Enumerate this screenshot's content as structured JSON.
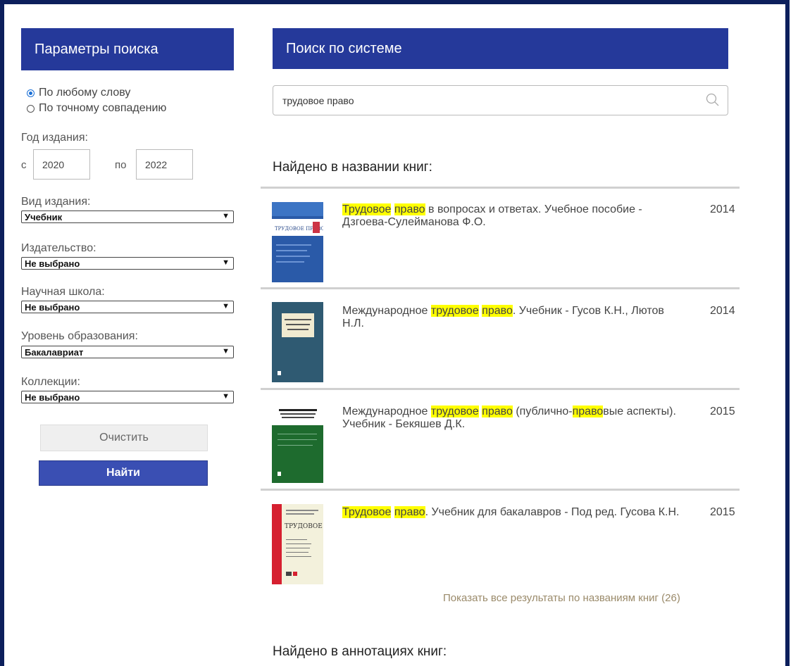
{
  "sidebar": {
    "title": "Параметры поиска",
    "match_any": "По любому слову",
    "match_exact": "По точному совпадению",
    "year_label": "Год издания:",
    "year_from_prefix": "с",
    "year_from": "2020",
    "year_to_prefix": "по",
    "year_to": "2022",
    "type_label": "Вид издания:",
    "type_value": "Учебник",
    "publisher_label": "Издательство:",
    "publisher_value": "Не выбрано",
    "school_label": "Научная школа:",
    "school_value": "Не выбрано",
    "level_label": "Уровень образования:",
    "level_value": "Бакалавриат",
    "collections_label": "Коллекции:",
    "collections_value": "Не выбрано",
    "clear_label": "Очистить",
    "find_label": "Найти"
  },
  "main": {
    "title": "Поиск по системе",
    "query": "трудовое право",
    "found_in_titles": "Найдено в названии книг:",
    "results": [
      {
        "parts": [
          {
            "t": "Трудовое",
            "h": true
          },
          {
            "t": " ",
            "h": false
          },
          {
            "t": "право",
            "h": true
          },
          {
            "t": " в вопросах и ответах. Учебное пособие - Дзгоева-Сулейманова Ф.О.",
            "h": false
          }
        ],
        "year": "2014"
      },
      {
        "parts": [
          {
            "t": "Международное ",
            "h": false
          },
          {
            "t": "трудовое",
            "h": true
          },
          {
            "t": " ",
            "h": false
          },
          {
            "t": "право",
            "h": true
          },
          {
            "t": ". Учебник - Гусов К.Н., Лютов Н.Л.",
            "h": false
          }
        ],
        "year": "2014"
      },
      {
        "parts": [
          {
            "t": "Международное ",
            "h": false
          },
          {
            "t": "трудовое",
            "h": true
          },
          {
            "t": " ",
            "h": false
          },
          {
            "t": "право",
            "h": true
          },
          {
            "t": " (публично-",
            "h": false
          },
          {
            "t": "право",
            "h": true
          },
          {
            "t": "вые аспекты). Учебник - Бекяшев Д.К.",
            "h": false
          }
        ],
        "year": "2015"
      },
      {
        "parts": [
          {
            "t": "Трудовое",
            "h": true
          },
          {
            "t": " ",
            "h": false
          },
          {
            "t": "право",
            "h": true
          },
          {
            "t": ". Учебник для бакалавров - Под ред. Гусова К.Н.",
            "h": false
          }
        ],
        "year": "2015"
      }
    ],
    "show_all": "Показать все результаты по названиям книг (26)",
    "found_in_annotations": "Найдено в аннотациях книг:",
    "cover1_title": "ТРУДОВОЕ ПРАВО",
    "cover4_title": "ТРУДОВОЕ"
  }
}
